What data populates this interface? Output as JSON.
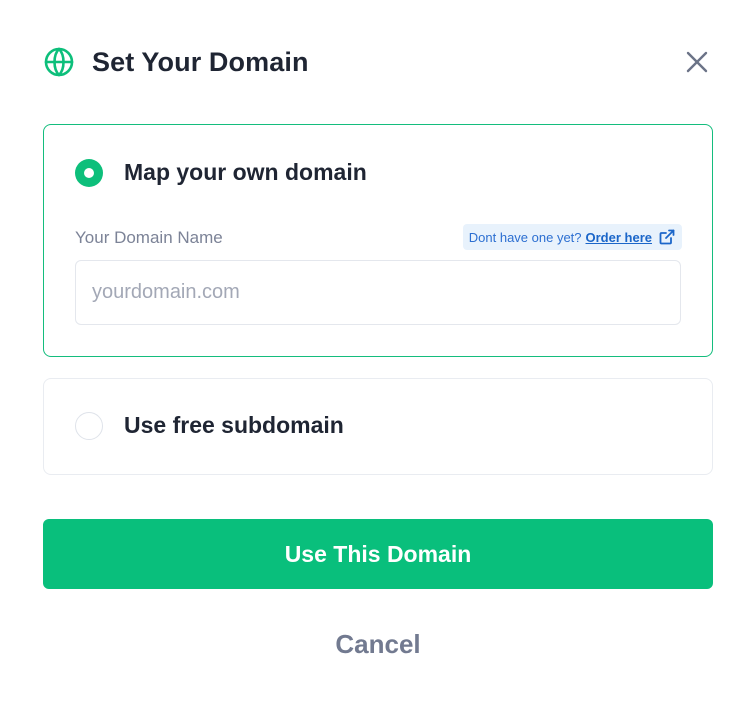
{
  "dialog": {
    "title": "Set Your Domain",
    "title_icon": "globe-icon",
    "close_icon": "close-icon"
  },
  "options": {
    "own_domain": {
      "label": "Map your own domain",
      "selected": true,
      "field_label": "Your Domain Name",
      "hint_text": "Dont have one yet?",
      "hint_link": "Order here",
      "hint_icon": "external-link-icon",
      "input_value": "",
      "input_placeholder": "yourdomain.com"
    },
    "free_subdomain": {
      "label": "Use free subdomain",
      "selected": false
    }
  },
  "actions": {
    "primary_label": "Use This Domain",
    "cancel_label": "Cancel"
  },
  "colors": {
    "accent": "#09bf7c",
    "selected_border": "#14bd7d",
    "link": "#1b66c9",
    "text": "#1f2533",
    "muted": "#727a90"
  }
}
